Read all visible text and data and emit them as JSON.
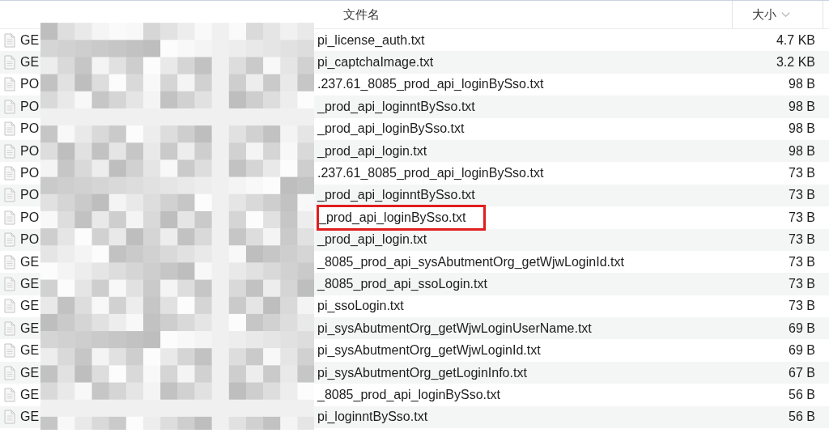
{
  "table": {
    "columns": [
      {
        "label": "文件名"
      },
      {
        "label": "大小",
        "sorted": true
      }
    ],
    "redacted": true,
    "rows": [
      {
        "prefix": "GE",
        "name": "pi_license_auth.txt",
        "size": "4.7 KB",
        "highlighted": false
      },
      {
        "prefix": "GE",
        "name": "pi_captchaImage.txt",
        "size": "3.2 KB",
        "highlighted": false
      },
      {
        "prefix": "PO",
        "name": ".237.61_8085_prod_api_loginBySso.txt",
        "size": "98 B",
        "highlighted": false
      },
      {
        "prefix": "PO",
        "name": "_prod_api_loginntBySso.txt",
        "size": "98 B",
        "highlighted": false
      },
      {
        "prefix": "PO",
        "name": "_prod_api_loginBySso.txt",
        "size": "98 B",
        "highlighted": false
      },
      {
        "prefix": "PO",
        "name": "_prod_api_login.txt",
        "size": "98 B",
        "highlighted": false
      },
      {
        "prefix": "PO",
        "name": ".237.61_8085_prod_api_loginBySso.txt",
        "size": "73 B",
        "highlighted": false
      },
      {
        "prefix": "PO",
        "name": "_prod_api_loginntBySso.txt",
        "size": "73 B",
        "highlighted": false
      },
      {
        "prefix": "PO",
        "name": "_prod_api_loginBySso.txt",
        "size": "73 B",
        "highlighted": true
      },
      {
        "prefix": "PO",
        "name": "_prod_api_login.txt",
        "size": "73 B",
        "highlighted": false
      },
      {
        "prefix": "GE",
        "name": "_8085_prod_api_sysAbutmentOrg_getWjwLoginId.txt",
        "size": "73 B",
        "highlighted": false
      },
      {
        "prefix": "GE",
        "name": "_8085_prod_api_ssoLogin.txt",
        "size": "73 B",
        "highlighted": false
      },
      {
        "prefix": "GE",
        "name": "pi_ssoLogin.txt",
        "size": "73 B",
        "highlighted": false
      },
      {
        "prefix": "GE",
        "name": "pi_sysAbutmentOrg_getWjwLoginUserName.txt",
        "size": "69 B",
        "highlighted": false
      },
      {
        "prefix": "GE",
        "name": "pi_sysAbutmentOrg_getWjwLoginId.txt",
        "size": "69 B",
        "highlighted": false
      },
      {
        "prefix": "GE",
        "name": "pi_sysAbutmentOrg_getLoginInfo.txt",
        "size": "67 B",
        "highlighted": false
      },
      {
        "prefix": "GE",
        "name": "_8085_prod_api_loginBySso.txt",
        "size": "56 B",
        "highlighted": false
      },
      {
        "prefix": "GE",
        "name": "pi_loginntBySso.txt",
        "size": "56 B",
        "highlighted": false
      }
    ]
  }
}
